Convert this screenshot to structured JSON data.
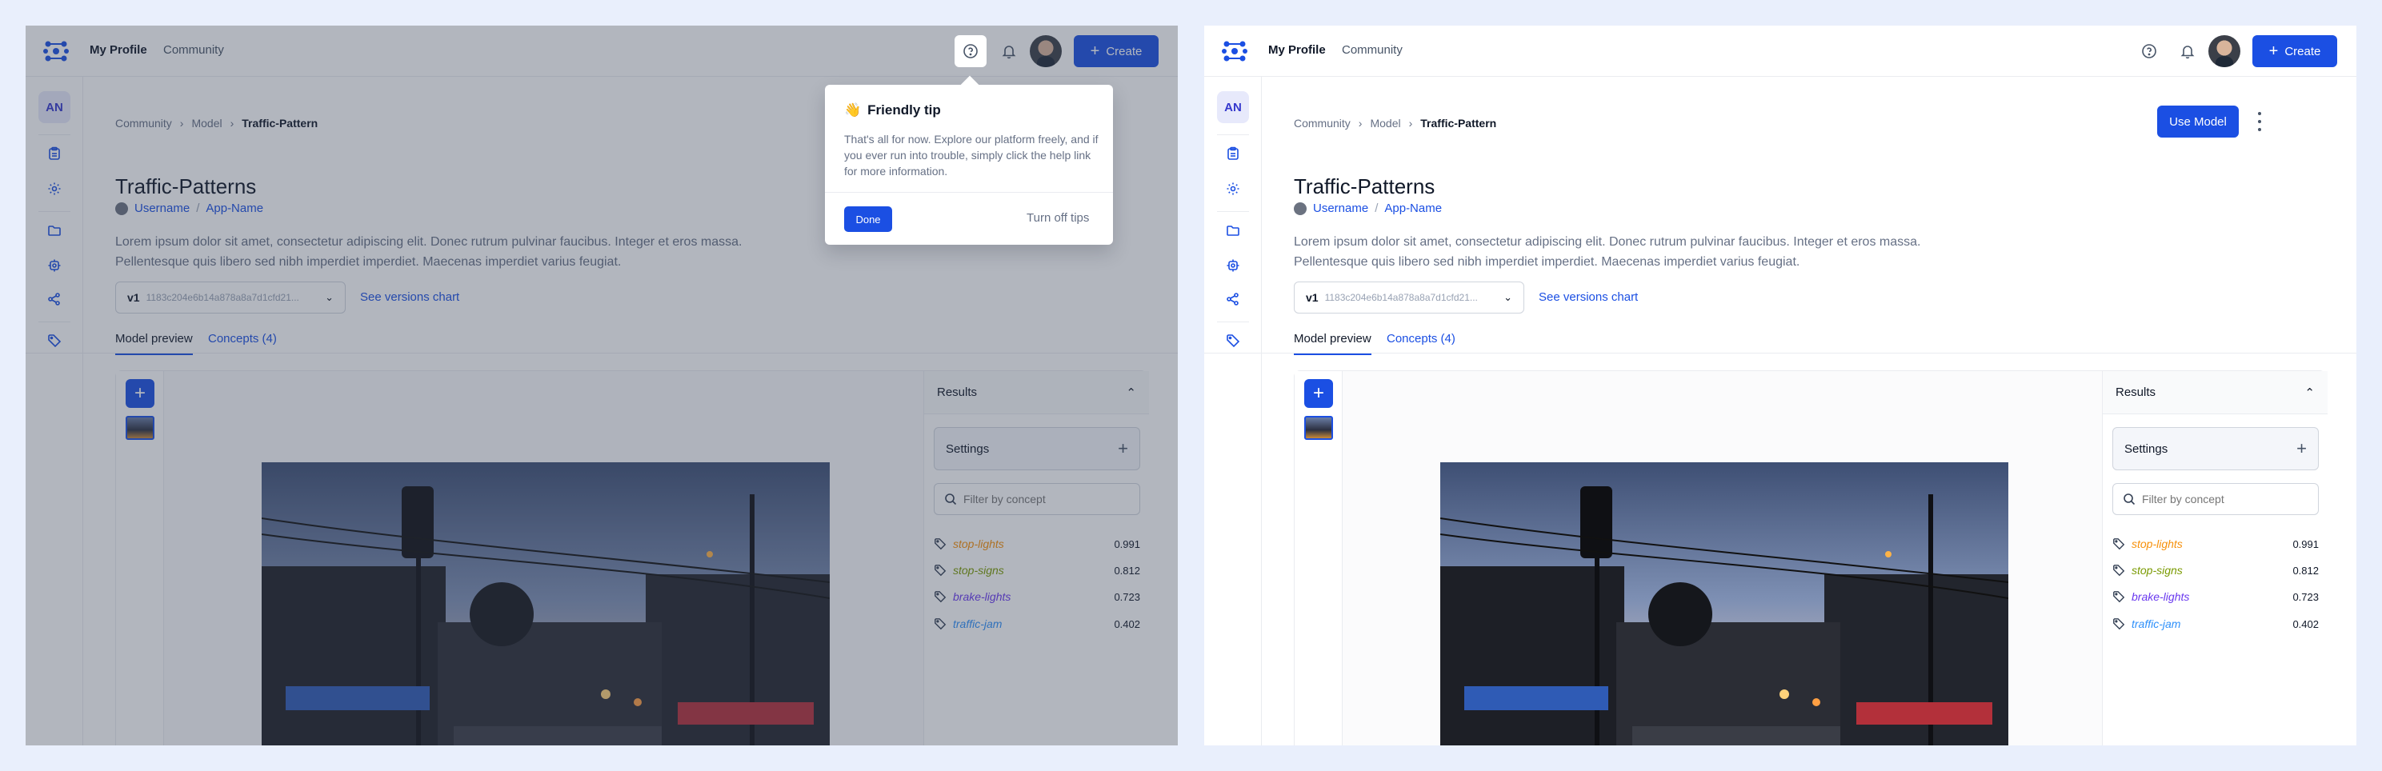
{
  "nav": {
    "my_profile": "My Profile",
    "community": "Community",
    "create_label": "Create",
    "icons": [
      "help-circle-icon",
      "bell-icon"
    ]
  },
  "sidebar": {
    "avatar_initials": "AN",
    "icons": [
      "clipboard-icon",
      "gear-icon",
      "folder-icon",
      "model-icon",
      "share-icon",
      "tag-icon"
    ]
  },
  "breadcrumb": [
    "Community",
    "Model",
    "Traffic-Pattern"
  ],
  "page": {
    "title": "Traffic-Patterns",
    "username": "Username",
    "owner_sep": "/",
    "app_name": "App-Name",
    "description": "Lorem ipsum dolor sit amet, consectetur adipiscing elit. Donec rutrum pulvinar faucibus. Integer et eros massa. Pellentesque quis libero sed nibh imperdiet imperdiet. Maecenas imperdiet varius feugiat.",
    "version": "v1",
    "version_hash": "1183c204e6b14a878a8a7d1cfd21...",
    "see_versions": "See versions chart",
    "use_model": "Use Model"
  },
  "tabs": [
    "Model preview",
    "Concepts (4)"
  ],
  "results": {
    "title": "Results",
    "settings_label": "Settings",
    "filter_placeholder": "Filter by concept",
    "concepts": [
      {
        "name": "stop-lights",
        "score": "0.991",
        "color": "#f79009"
      },
      {
        "name": "stop-signs",
        "score": "0.812",
        "color": "#7a9a01"
      },
      {
        "name": "brake-lights",
        "score": "0.723",
        "color": "#6938ef"
      },
      {
        "name": "traffic-jam",
        "score": "0.402",
        "color": "#2e90fa"
      }
    ]
  },
  "tip": {
    "emoji": "👋",
    "title": "Friendly tip",
    "body": "That's all for now. Explore our platform freely, and if you ever run into trouble, simply click the help link for more information.",
    "done": "Done",
    "turn_off": "Turn off tips"
  },
  "colors": {
    "accent": "#1b4fe3",
    "background": "#e9effc"
  }
}
